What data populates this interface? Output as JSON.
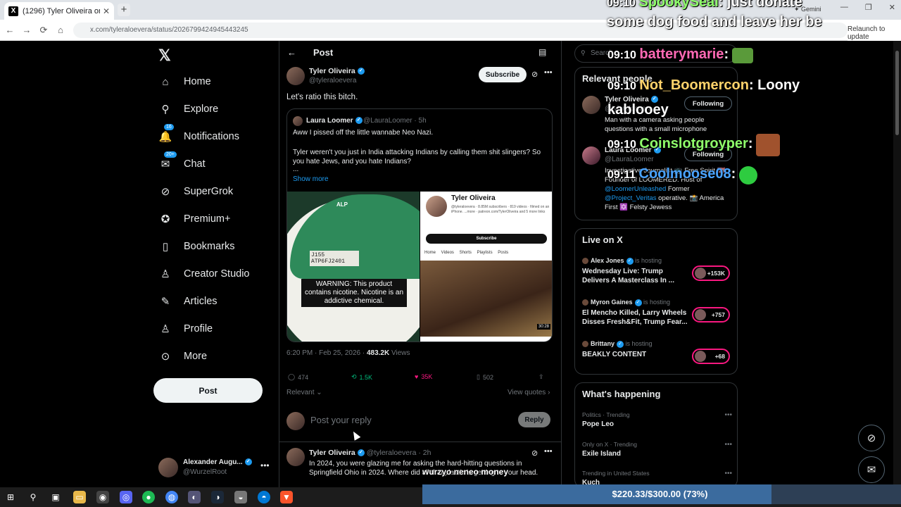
{
  "browser": {
    "tab_title": "(1296) Tyler Oliveira on X: \"Let's",
    "tab_close": "✕",
    "new_tab": "+",
    "url": "x.com/tyleraloevera/status/2026799424945443245",
    "gemini": "✦ Gemini",
    "relaunch": "Relaunch to update",
    "win_min": "—",
    "win_max": "❐",
    "win_close": "✕",
    "back": "←",
    "forward": "→",
    "reload": "⟳",
    "home": "⌂",
    "x_logo": "X"
  },
  "nav": {
    "brand": "𝕏",
    "items": [
      {
        "label": "Home",
        "icon": "⌂"
      },
      {
        "label": "Explore",
        "icon": "⚲"
      },
      {
        "label": "Notifications",
        "icon": "🔔",
        "badge": "16"
      },
      {
        "label": "Chat",
        "icon": "✉",
        "badge": "20+"
      },
      {
        "label": "SuperGrok",
        "icon": "⊘"
      },
      {
        "label": "Premium+",
        "icon": "✪"
      },
      {
        "label": "Bookmarks",
        "icon": "▯"
      },
      {
        "label": "Creator Studio",
        "icon": "♙"
      },
      {
        "label": "Articles",
        "icon": "✎"
      },
      {
        "label": "Profile",
        "icon": "♙"
      },
      {
        "label": "More",
        "icon": "⊙"
      }
    ],
    "post_button": "Post",
    "account": {
      "name": "Alexander Augu...",
      "handle": "@WurzelRoot",
      "dots": "•••"
    }
  },
  "post": {
    "header": "Post",
    "back": "←",
    "reader": "▤",
    "author_name": "Tyler Oliveira",
    "author_handle": "@tyleraloevera",
    "subscribe": "Subscribe",
    "grok": "⊘",
    "dots": "•••",
    "text": "Let's ratio this bitch.",
    "quote": {
      "name": "Laura Loomer",
      "handle": "@LauraLoomer · 5h",
      "line1": "Aww I pissed off the little wannabe Neo Nazi.",
      "line2": "Tyler weren't you just in India attacking Indians by calling them shit slingers? So you hate Jews, and you hate Indians?",
      "line3": "...",
      "show_more": "Show more",
      "img1": {
        "brand": "ALP",
        "code": "J155 ATP6FJ2401",
        "warning": "WARNING: This product contains nicotine. Nicotine is an addictive chemical."
      },
      "img2": {
        "name": "Tyler Oliveira",
        "sub": "@tyleraloevera · 8.85M subscribers · 819 videos · filmed on an iPhone. ...more · patreon.com/TylerOliveira and 5 more links",
        "subscribe": "Subscribe",
        "tabs": "Home Videos Shorts Playlists Posts",
        "duration": "30:28"
      }
    },
    "time": "6:20 PM · Feb 25, 2026 · ",
    "views_count": "483.2K",
    "views_label": " Views",
    "replies": "474",
    "reposts": "1.5K",
    "likes": "35K",
    "bookmarks": "502",
    "icons": {
      "reply": "◯",
      "repost": "⟲",
      "like": "♥",
      "bookmark": "▯",
      "share": "⇪"
    },
    "relevant": "Relevant ⌄",
    "view_quotes": "View quotes ›",
    "reply_placeholder": "Post your reply",
    "reply_button": "Reply",
    "reply2": {
      "name": "Tyler Oliveira",
      "handle": "@tyleraloevera · 2h",
      "text": "In 2024, you were glazing me for asking the hard-hitting questions in Springfield Ohio in 2024. Where did all that plastic is getting to your head."
    }
  },
  "right": {
    "search_placeholder": "Search",
    "search_icon": "⚲",
    "relevant_title": "Relevant people",
    "people": [
      {
        "name": "Tyler Oliveira",
        "handle": "@tyleraloevera",
        "button": "Following",
        "bio": "Man with a camera asking people questions with a small microphone"
      },
      {
        "name": "Laura Loomer",
        "handle": "@LauraLoomer",
        "button": "Following",
        "bio_pre": "Investigative Journalist 📺 Free Spirit 🇺🇸 Founder of LOOMERED. Host of ",
        "bio_link1": "@LoomerUnleashed",
        "bio_mid": " Former ",
        "bio_link2": "@Project_Veritas",
        "bio_post": " operative. 📸 America First ✡️ Felsty Jewess"
      }
    ],
    "live_title": "Live on X",
    "live": [
      {
        "host": "Alex Jones",
        "is_hosting": " is hosting",
        "title": "Wednesday Live: Trump Delivers A Masterclass In ...",
        "count": "+153K"
      },
      {
        "host": "Myron Gaines",
        "is_hosting": " is hosting",
        "title": "El Mencho Killed, Larry Wheels Disses Fresh&Fit, Trump Fear...",
        "count": "+757"
      },
      {
        "host": "Brittany",
        "is_hosting": " is hosting",
        "title": "BEAKLY CONTENT",
        "count": "+68"
      }
    ],
    "happening_title": "What's happening",
    "trends": [
      {
        "cat": "Politics · Trending",
        "name": "Pope Leo"
      },
      {
        "cat": "Only on X · Trending",
        "name": "Exile Island"
      },
      {
        "cat": "Trending in United States",
        "name": "Kuch"
      }
    ],
    "trend_dots": "•••",
    "grok_float": "⊘",
    "mail_float": "✉"
  },
  "chat": {
    "top_msg_user": "SpookySeal",
    "top_msg": ": just donate",
    "top_msg_time": "09:10",
    "top_msg2": "some dog food and leave her be",
    "lines": [
      {
        "time": "09:10",
        "user": "batterymarie",
        "msg": ":",
        "color": "#ff69b4"
      },
      {
        "time": "09:10",
        "user": "Not_Boomercon",
        "msg": ": Loony",
        "color": "#ffd36b"
      },
      {
        "msg2": "kablooey"
      },
      {
        "time": "09:10",
        "user": "Coinslotgroyper",
        "msg": ":",
        "color": "#8fff6b"
      },
      {
        "time": "09:11",
        "user": "Coolmoose08",
        "msg": ":",
        "color": "#4aa3ff"
      }
    ],
    "overlay_text": "wurzyo neneo money"
  },
  "donation": {
    "label": "$220.33/$300.00 (73%)",
    "progress": 0.73
  },
  "taskbar": {
    "icons": [
      "⊞",
      "⚲",
      "▣",
      "▭",
      "◉",
      "◎",
      "●",
      "◍",
      "◐",
      "◑",
      "◒",
      "◓",
      "▼"
    ]
  },
  "colors": {
    "accent": "#1d9bf0",
    "like": "#f91880",
    "repost": "#00ba7c"
  }
}
